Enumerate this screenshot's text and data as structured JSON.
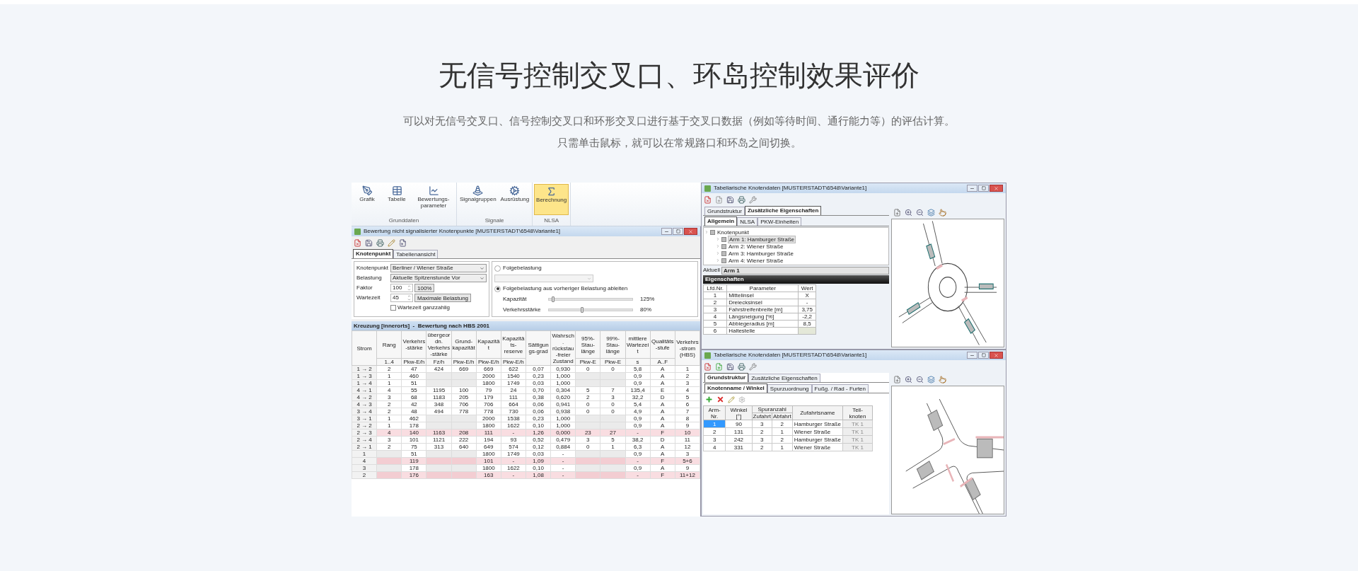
{
  "header": {
    "title": "无信号控制交叉口、环岛控制效果评价",
    "description": [
      "可以对无信号交叉口、信号控制交叉口和环形交叉口进行基于交叉口数据（例如等待时间、通行能力等）的评估计算。",
      "只需单击鼠标，就可以在常规路口和环岛之间切换。"
    ]
  },
  "screenshot": {
    "ribbon": {
      "groups": [
        {
          "label": "Grunddaten",
          "buttons": [
            {
              "label": "Grafik",
              "selected": false
            },
            {
              "label": "Tabelle",
              "selected": false
            },
            {
              "label": "Bewertungs-parameter",
              "selected": false
            }
          ]
        },
        {
          "label": "Signale",
          "buttons": [
            {
              "label": "Signalgruppen",
              "selected": false
            },
            {
              "label": "Ausrüstung",
              "selected": false
            }
          ]
        },
        {
          "label": "NLSA",
          "buttons": [
            {
              "label": "Berechnung",
              "selected": true
            }
          ]
        }
      ]
    },
    "main_window": {
      "title": "Bewertung nicht signalisierter Knotenpunkte [MUSTERSTADT\\6548\\Variante1]",
      "tabs": [
        {
          "label": "Knotenpunkt",
          "selected": true
        },
        {
          "label": "Tabellenansicht",
          "selected": false
        }
      ],
      "fields": [
        {
          "label": "Knotenpunkt",
          "kind": "select",
          "value": "Berliner / Wiener Straße"
        },
        {
          "label": "Belastung",
          "kind": "select",
          "value": "Aktuelle Spitzenstunde Vor"
        },
        {
          "label": "Faktor",
          "kind": "spin",
          "value": "100",
          "button": "100%"
        },
        {
          "label": "Wartezeit",
          "kind": "spin",
          "value": "45",
          "button": "Maximale Belastung"
        }
      ],
      "checkbox": {
        "label": "Wartezeit ganzzahlig",
        "checked": false
      },
      "load_options": [
        {
          "label": "Folgebelastung",
          "selected": false
        },
        {
          "label": "Folgebelastung aus vorheriger Belastung ableiten",
          "selected": true
        }
      ],
      "sliders": [
        {
          "label": "Kapazität",
          "level": 0.05,
          "reading": "125%"
        },
        {
          "label": "Verkehrsstärke",
          "level": 0.4,
          "reading": "80%"
        }
      ],
      "table": {
        "title": "Kreuzung [innerorts]  -  Bewertung nach HBS 2001",
        "columns": [
          {
            "name": "Strom"
          },
          {
            "name": "Rang",
            "unit": "1..4"
          },
          {
            "name": "Verkehrs-stärke",
            "unit": "Pkw-E/h"
          },
          {
            "name": "übergeordn. Verkehrs-stärke",
            "unit": "Fz/h"
          },
          {
            "name": "Grund-kapazität",
            "unit": "Pkw-E/h"
          },
          {
            "name": "Kapazität",
            "unit": "Pkw-E/h"
          },
          {
            "name": "Kapazitäts-reserve",
            "unit": "Pkw-E/h"
          },
          {
            "name": "Sättigungs-grad"
          },
          {
            "name": "Wahrsch. rückstau-freier Zustand"
          },
          {
            "name": "95%-Stau-länge",
            "unit": "Pkw-E"
          },
          {
            "name": "99%-Stau-länge",
            "unit": "Pkw-E"
          },
          {
            "name": "mittlere Wartezeit",
            "unit": "s"
          },
          {
            "name": "Qualitäts-stufe",
            "unit": "A..F"
          },
          {
            "name": "Verkehrs-strom (HBS)"
          }
        ],
        "rows": [
          {
            "flagged": false,
            "cells": [
              "1 → 2",
              "2",
              "47",
              "424",
              "669",
              "669",
              "622",
              "0,07",
              "0,930",
              "0",
              "0",
              "5,8",
              "A",
              "1"
            ]
          },
          {
            "flagged": false,
            "cells": [
              "1 → 3",
              "1",
              "460",
              null,
              null,
              "2000",
              "1540",
              "0,23",
              "1,000",
              null,
              null,
              "0,9",
              "A",
              "2"
            ]
          },
          {
            "flagged": false,
            "cells": [
              "1 → 4",
              "1",
              "51",
              null,
              null,
              "1800",
              "1749",
              "0,03",
              "1,000",
              null,
              null,
              "0,9",
              "A",
              "3"
            ]
          },
          {
            "flagged": false,
            "cells": [
              "4 → 1",
              "4",
              "55",
              "1195",
              "100",
              "79",
              "24",
              "0,70",
              "0,304",
              "5",
              "7",
              "135,4",
              "E",
              "4"
            ]
          },
          {
            "flagged": false,
            "cells": [
              "4 → 2",
              "3",
              "68",
              "1183",
              "205",
              "179",
              "111",
              "0,38",
              "0,620",
              "2",
              "3",
              "32,2",
              "D",
              "5"
            ]
          },
          {
            "flagged": false,
            "cells": [
              "4 → 3",
              "2",
              "42",
              "348",
              "706",
              "706",
              "664",
              "0,06",
              "0,941",
              "0",
              "0",
              "5,4",
              "A",
              "6"
            ]
          },
          {
            "flagged": false,
            "cells": [
              "3 → 4",
              "2",
              "48",
              "494",
              "778",
              "778",
              "730",
              "0,06",
              "0,938",
              "0",
              "0",
              "4,9",
              "A",
              "7"
            ]
          },
          {
            "flagged": false,
            "cells": [
              "3 → 1",
              "1",
              "462",
              null,
              null,
              "2000",
              "1538",
              "0,23",
              "1,000",
              null,
              null,
              "0,9",
              "A",
              "8"
            ]
          },
          {
            "flagged": false,
            "cells": [
              "2 → 2",
              "1",
              "178",
              null,
              null,
              "1800",
              "1622",
              "0,10",
              "1,000",
              null,
              null,
              "0,9",
              "A",
              "9"
            ]
          },
          {
            "flagged": true,
            "cells": [
              "2 → 3",
              "4",
              "140",
              "1163",
              "208",
              "111",
              "-",
              "1,26",
              "0,000",
              "23",
              "27",
              "-",
              "F",
              "10"
            ]
          },
          {
            "flagged": false,
            "cells": [
              "2 → 4",
              "3",
              "101",
              "1121",
              "222",
              "194",
              "93",
              "0,52",
              "0,479",
              "3",
              "5",
              "38,2",
              "D",
              "11"
            ]
          },
          {
            "flagged": false,
            "cells": [
              "2 → 1",
              "2",
              "75",
              "313",
              "640",
              "649",
              "574",
              "0,12",
              "0,884",
              "0",
              "1",
              "6,3",
              "A",
              "12"
            ]
          },
          {
            "flagged": false,
            "cells": [
              "1",
              null,
              "51",
              null,
              null,
              "1800",
              "1749",
              "0,03",
              "-",
              null,
              null,
              "0,9",
              "A",
              "3"
            ]
          },
          {
            "flagged": true,
            "cells": [
              "4",
              null,
              "119",
              null,
              null,
              "101",
              "-",
              "1,09",
              "-",
              null,
              null,
              "-",
              "F",
              "5+6"
            ]
          },
          {
            "flagged": false,
            "cells": [
              "3",
              null,
              "178",
              null,
              null,
              "1800",
              "1622",
              "0,10",
              "-",
              null,
              null,
              "0,9",
              "A",
              "9"
            ]
          },
          {
            "flagged": true,
            "cells": [
              "2",
              null,
              "176",
              null,
              null,
              "163",
              "-",
              "1,08",
              "-",
              null,
              null,
              "-",
              "F",
              "11+12"
            ]
          }
        ]
      }
    },
    "node_window": {
      "title": "Tabellarische Knotendaten [MUSTERSTADT\\6548\\Variante1]",
      "tabs": [
        {
          "label": "Grundstruktur",
          "selected": false
        },
        {
          "label": "Zusätzliche Eigenschaften",
          "selected": true
        }
      ],
      "subtabs": [
        {
          "label": "Allgemein",
          "selected": true
        },
        {
          "label": "NLSA",
          "selected": false
        },
        {
          "label": "PKW-Einheiten",
          "selected": false
        }
      ],
      "tree": [
        {
          "label": "Knotenpunkt",
          "selected": false,
          "expanded": true,
          "children": [
            {
              "label": "Arm 1: Hamburger Straße",
              "selected": true
            },
            {
              "label": "Arm 2: Wiener Straße",
              "selected": false
            },
            {
              "label": "Arm 3: Hamburger Straße",
              "selected": false
            },
            {
              "label": "Arm 4: Wiener Straße",
              "selected": false
            }
          ]
        }
      ],
      "current": {
        "label": "Aktuell",
        "value": "Arm 1"
      },
      "properties": {
        "title": "Eigenschaften",
        "columns": [
          "Lfd.Nr.",
          "Parameter",
          "Wert"
        ],
        "rows": [
          {
            "no": "1",
            "parameter": "Mittelinsel",
            "value": "X"
          },
          {
            "no": "2",
            "parameter": "Dreiecksinsel",
            "value": "-"
          },
          {
            "no": "3",
            "parameter": "Fahrstreifenbreite [m]",
            "value": "3,75"
          },
          {
            "no": "4",
            "parameter": "Längsneigung [%]",
            "value": "-2,2"
          },
          {
            "no": "5",
            "parameter": "Abbiegeradius [m]",
            "value": "8,5"
          },
          {
            "no": "6",
            "parameter": "Haltestelle"
          }
        ]
      }
    },
    "arm_window": {
      "title": "Tabellarische Knotendaten [MUSTERSTADT\\6548\\Variante1]",
      "tabs": [
        {
          "label": "Grundstruktur",
          "selected": true
        },
        {
          "label": "Zusätzliche Eigenschaften",
          "selected": false
        }
      ],
      "subtabs": [
        {
          "label": "Knotenname / Winkel",
          "selected": true
        },
        {
          "label": "Spurzuordnung",
          "selected": false
        },
        {
          "label": "Fußg. / Rad - Furten",
          "selected": false
        }
      ],
      "columns": [
        {
          "name": "Arm-Nr."
        },
        {
          "name": "Winkel [°]"
        },
        {
          "name": "Spuranzahl",
          "colspan": 2,
          "children": [
            {
              "name": "Zufahrt"
            },
            {
              "name": "Abfahrt"
            }
          ]
        },
        {
          "name": "Zufahrtsname"
        },
        {
          "name": "Teil-knoten"
        }
      ],
      "rows": [
        {
          "selected": true,
          "cells": [
            "1",
            "90",
            "3",
            "2",
            "Hamburger Straße",
            "TK 1"
          ]
        },
        {
          "selected": false,
          "cells": [
            "2",
            "131",
            "2",
            "1",
            "Wiener Straße",
            "TK 1"
          ]
        },
        {
          "selected": false,
          "cells": [
            "3",
            "242",
            "3",
            "2",
            "Hamburger Straße",
            "TK 1"
          ]
        },
        {
          "selected": false,
          "cells": [
            "4",
            "331",
            "2",
            "1",
            "Wiener Straße",
            "TK 1"
          ]
        }
      ]
    }
  }
}
